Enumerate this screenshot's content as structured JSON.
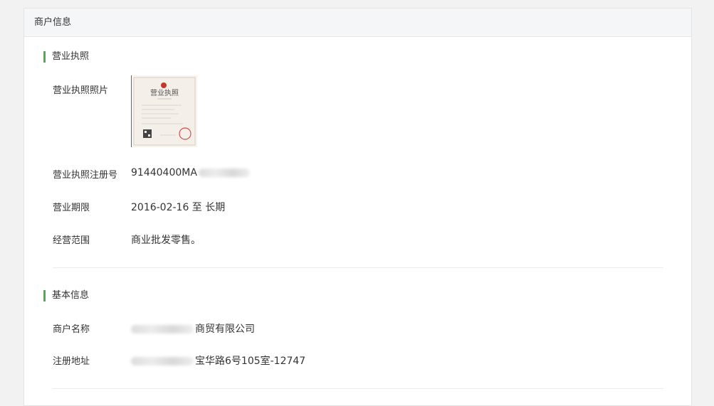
{
  "header": {
    "title": "商户信息"
  },
  "license_section": {
    "title": "营业执照",
    "photo_label": "营业执照照片",
    "photo_caption": "营业执照",
    "reg_no_label": "营业执照注册号",
    "reg_no_value": "91440400MA",
    "term_label": "营业期限",
    "term_value": "2016-02-16 至 长期",
    "scope_label": "经营范围",
    "scope_value": "商业批发零售。"
  },
  "basic_section": {
    "title": "基本信息",
    "name_label": "商户名称",
    "name_value": "商贸有限公司",
    "address_label": "注册地址",
    "address_value": "宝华路6号105室-12747"
  },
  "colors": {
    "accent": "#4cae4c"
  }
}
